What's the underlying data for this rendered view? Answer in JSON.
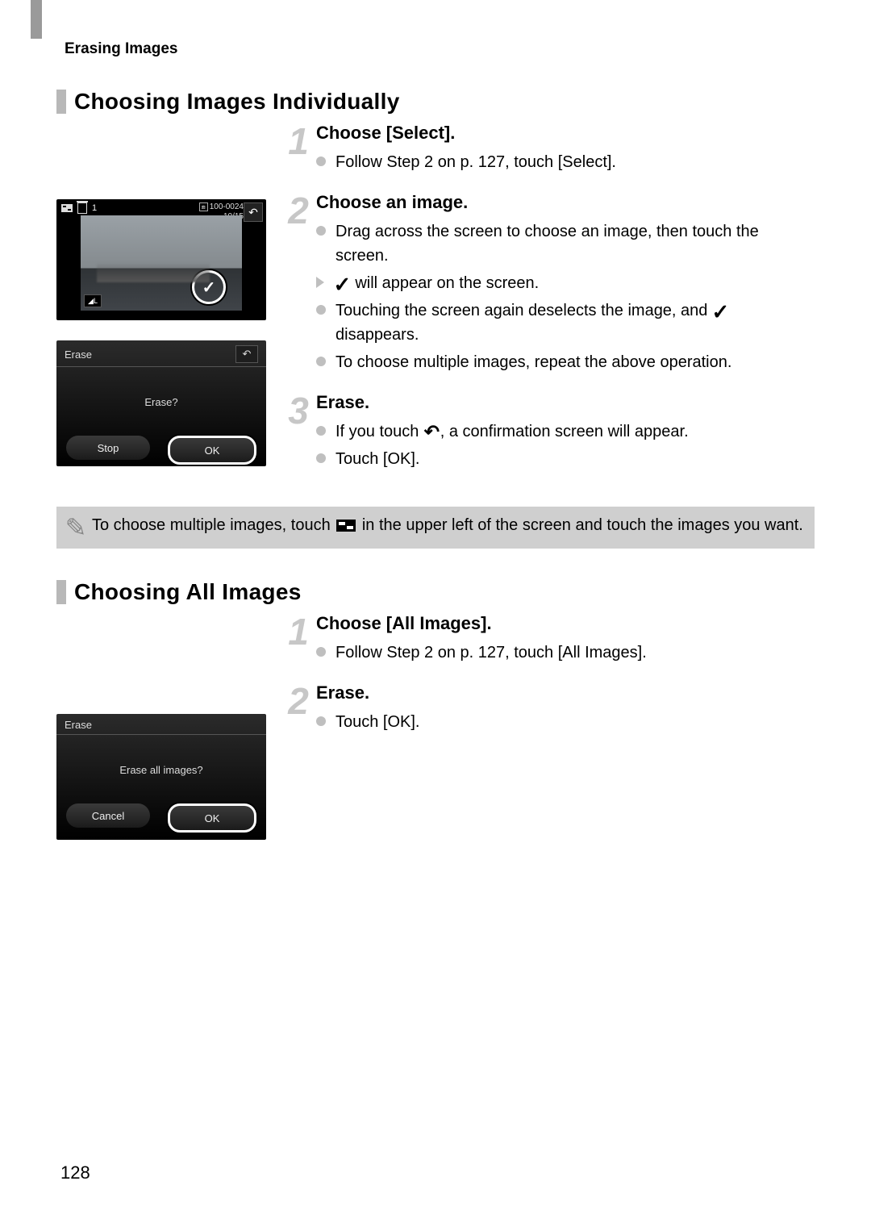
{
  "header": {
    "breadcrumb": "Erasing Images"
  },
  "section1": {
    "heading": "Choosing Images Individually",
    "step1": {
      "num": "1",
      "title": "Choose [Select].",
      "b1": "Follow Step 2 on p. 127, touch [Select]."
    },
    "step2": {
      "num": "2",
      "title": "Choose an image.",
      "b1": "Drag across the screen to choose an image, then touch the screen.",
      "b2a": "",
      "b2b": " will appear on the screen.",
      "b3a": "Touching the screen again deselects the image, and ",
      "b3b": " disappears.",
      "b4": "To choose multiple images, repeat the above operation."
    },
    "step3": {
      "num": "3",
      "title": "Erase.",
      "b1a": "If you touch ",
      "b1b": ", a confirmation screen will appear.",
      "b2": "Touch [OK]."
    },
    "tip": {
      "a": "To choose multiple images, touch ",
      "b": " in the upper left of the screen and touch the images you want."
    },
    "shot_scene": {
      "count": "1",
      "file": "100-0024",
      "date_counter": "10/15",
      "qual": "◢L",
      "check": "✓",
      "back": "↶"
    },
    "shot_dialog": {
      "title": "Erase",
      "back": "↶",
      "msg": "Erase?",
      "btn1": "Stop",
      "btn2": "OK"
    }
  },
  "section2": {
    "heading": "Choosing All Images",
    "step1": {
      "num": "1",
      "title": "Choose [All Images].",
      "b1": "Follow Step 2 on p. 127, touch [All Images]."
    },
    "step2": {
      "num": "2",
      "title": "Erase.",
      "b1": "Touch [OK]."
    },
    "shot_dialog": {
      "title": "Erase",
      "msg": "Erase all images?",
      "btn1": "Cancel",
      "btn2": "OK"
    }
  },
  "page_number": "128"
}
